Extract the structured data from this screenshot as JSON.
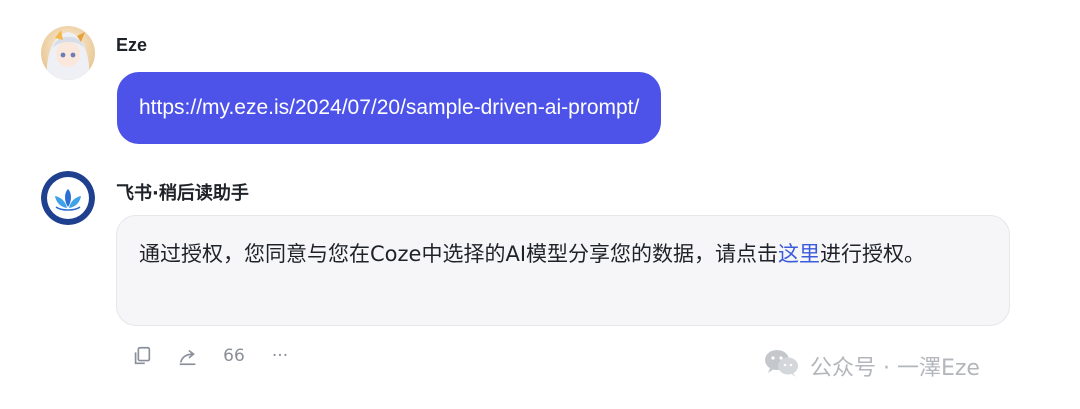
{
  "user_message": {
    "sender": "Eze",
    "text": "https://my.eze.is/2024/07/20/sample-driven-ai-prompt/"
  },
  "bot_message": {
    "sender": "飞书·稍后读助手",
    "text_before": "通过授权，您同意与您在Coze中选择的AI模型分享您的数据，请点击",
    "link_text": "这里",
    "text_after": "进行授权。"
  },
  "actions": {
    "copy_icon": "copy-icon",
    "share_icon": "share-icon",
    "quote_label": "66",
    "more_label": "···"
  },
  "watermark": {
    "text": "公众号 · 一澤Eze"
  },
  "colors": {
    "user_bubble": "#4d53e8",
    "bot_bubble": "#f6f6f8",
    "link": "#3b5bdb"
  }
}
